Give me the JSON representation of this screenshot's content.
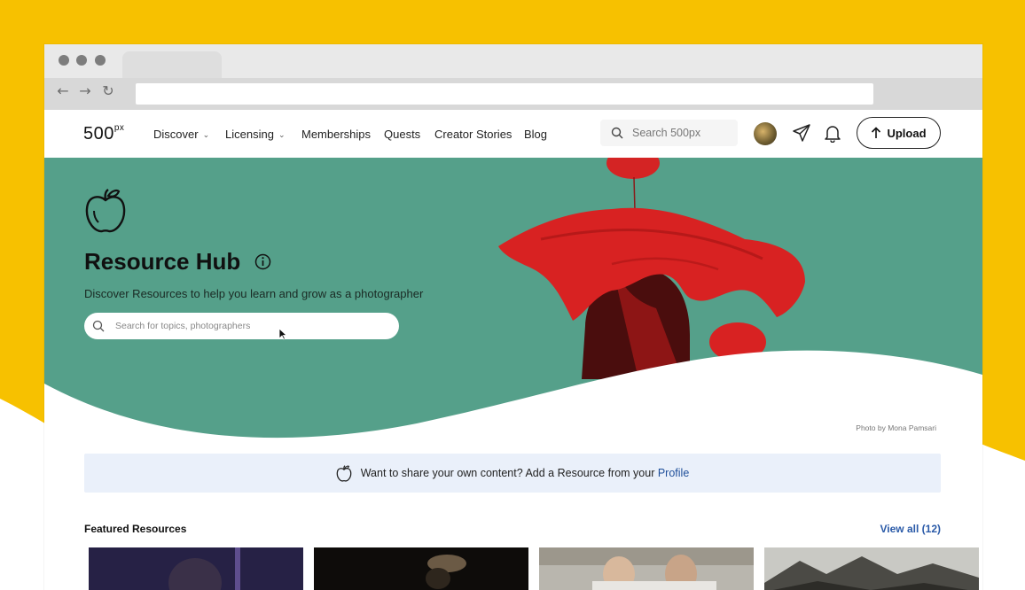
{
  "header": {
    "logo_text": "500",
    "logo_sup": "px",
    "nav": [
      {
        "label": "Discover",
        "has_menu": true
      },
      {
        "label": "Licensing",
        "has_menu": true
      },
      {
        "label": "Memberships",
        "has_menu": false
      },
      {
        "label": "Quests",
        "has_menu": false
      },
      {
        "label": "Creator Stories",
        "has_menu": false
      },
      {
        "label": "Blog",
        "has_menu": false
      }
    ],
    "search_placeholder": "Search 500px",
    "upload_label": "Upload",
    "icons": [
      "search-icon",
      "avatar",
      "send-icon",
      "bell-icon",
      "arrow-up-icon"
    ]
  },
  "hero": {
    "title": "Resource Hub",
    "subtitle": "Discover Resources to help you learn and grow as a photographer",
    "search_placeholder": "Search for topics, photographers",
    "photo_credit": "Photo by Mona Pamsari",
    "background_color": "#55a08a",
    "icons": [
      "apple-icon",
      "info-icon",
      "search-icon"
    ]
  },
  "share_banner": {
    "text": "Want to share your own content? Add a Resource from your",
    "link_label": "Profile",
    "icon": "apple-icon"
  },
  "featured": {
    "title": "Featured Resources",
    "view_all_label": "View all (12)"
  },
  "colors": {
    "backdrop_yellow": "#f7c100",
    "hero_green": "#55a08a",
    "banner_blue": "#eaf0fa",
    "link_blue": "#2a5aa8"
  }
}
